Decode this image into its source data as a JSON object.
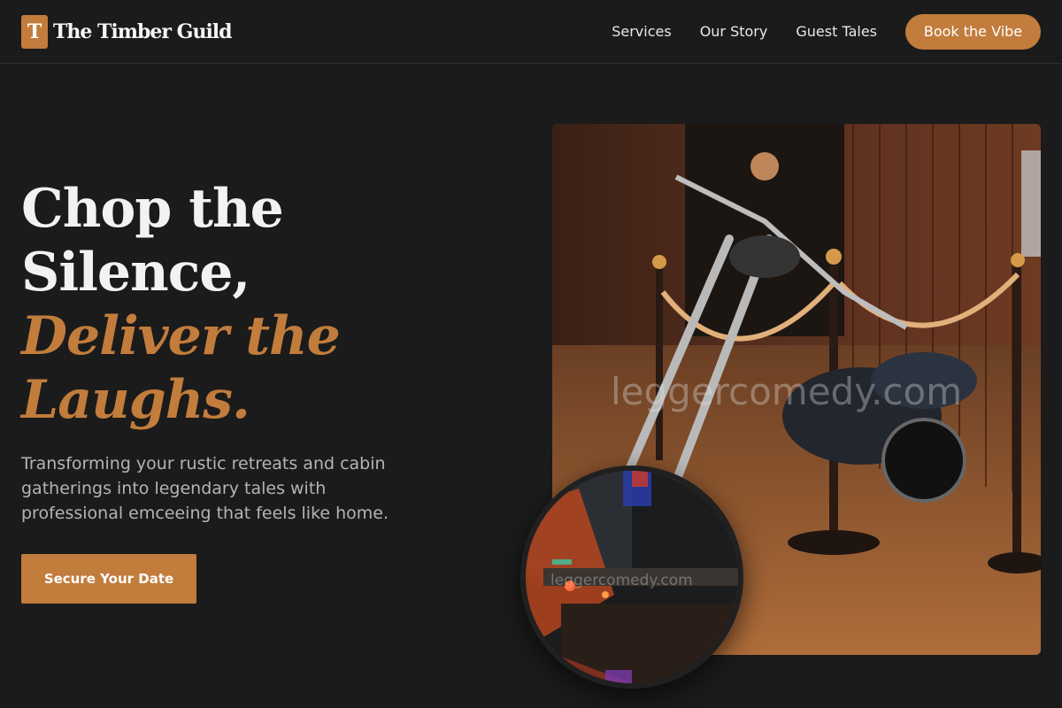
{
  "brand": {
    "mark": "T",
    "name": "The Timber Guild"
  },
  "nav": {
    "links": [
      "Services",
      "Our Story",
      "Guest Tales"
    ],
    "cta": "Book the Vibe"
  },
  "hero": {
    "line1": "Chop the",
    "line2": "Silence,",
    "line3": "Deliver the",
    "line4": "Laughs.",
    "subtitle": "Transforming your rustic retreats and cabin gatherings into legendary tales with professional emceeing that feels like home.",
    "button": "Secure Your Date"
  },
  "images": {
    "main_watermark": "leggercomedy.com",
    "circle_watermark": "leggercomedy.com"
  },
  "colors": {
    "accent": "#c27c3c",
    "background": "#1b1b1b"
  }
}
